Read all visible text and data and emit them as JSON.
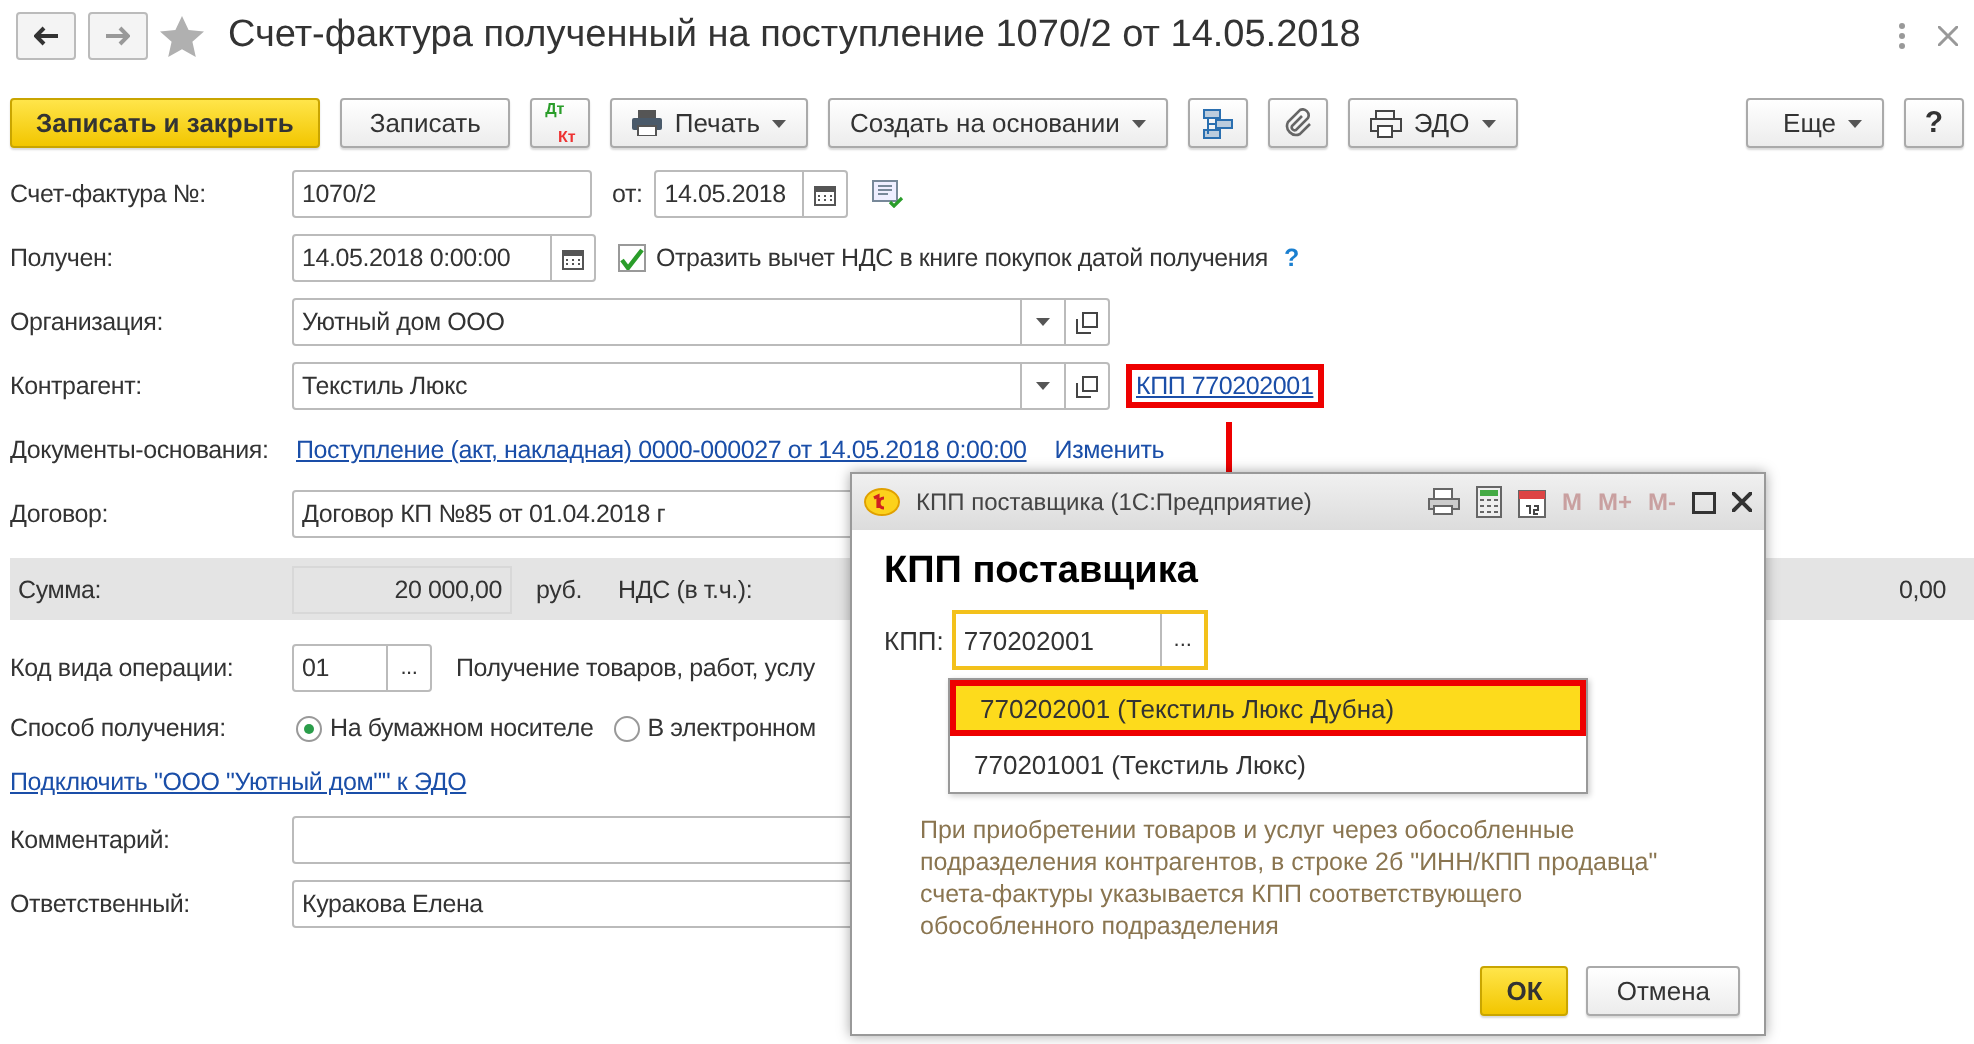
{
  "window": {
    "title": "Счет-фактура полученный на поступление 1070/2 от 14.05.2018",
    "favorite": false
  },
  "toolbar": {
    "save_close": "Записать и закрыть",
    "save": "Записать",
    "dt": "Дт",
    "kt": "Кт",
    "print": "Печать",
    "create_based": "Создать на основании",
    "edo": "ЭДО",
    "more": "Еще",
    "help": "?"
  },
  "form": {
    "invoice_no": {
      "label": "Счет-фактура №:",
      "value": "1070/2",
      "date_label": "от:",
      "date": "14.05.2018"
    },
    "received": {
      "label": "Получен:",
      "value": "14.05.2018  0:00:00",
      "vat_checkbox": {
        "label": "Отразить вычет НДС в книге покупок датой получения",
        "checked": true
      },
      "help": "?"
    },
    "organization": {
      "label": "Организация:",
      "value": "Уютный дом ООО"
    },
    "counterparty": {
      "label": "Контрагент:",
      "value": "Текстиль Люкс",
      "kpp_link": {
        "text": "КПП 770202001",
        "highlighted": true
      }
    },
    "base_documents": {
      "label": "Документы-основания:",
      "link": "Поступление (акт, накладная) 0000-000027 от 14.05.2018 0:00:00",
      "change_link": "Изменить"
    },
    "contract": {
      "label": "Договор:",
      "value": "Договор КП №85 от 01.04.2018 г"
    },
    "totals": {
      "sum_label": "Сумма:",
      "sum": "20 000,00",
      "currency": "руб.",
      "vat_label": "НДС (в т.ч.):",
      "vat": "0,00"
    },
    "operation_code": {
      "label": "Код вида операции:",
      "value": "01",
      "picker": "...",
      "description": "Получение товаров, работ, услу"
    },
    "receipt_method": {
      "label": "Способ получения:",
      "options": [
        {
          "label": "На бумажном носителе",
          "selected": true
        },
        {
          "label": "В электронном",
          "selected": false
        }
      ]
    },
    "edo_link": "Подключить \"ООО \"Уютный дом\"\" к ЭДО",
    "comment": {
      "label": "Комментарий:"
    },
    "responsible": {
      "label": "Ответственный:",
      "value": "Куракова Елена"
    }
  },
  "dialog": {
    "title": "КПП поставщика  (1С:Предприятие)",
    "memory_buttons": [
      "M",
      "M+",
      "M-"
    ],
    "heading": "КПП поставщика",
    "kpp_label": "КПП:",
    "kpp_value": "770202001",
    "picker": "...",
    "suggestions": [
      {
        "label": "770202001 (Текстиль Люкс Дубна)",
        "selected": true,
        "highlighted": true
      },
      {
        "label": "770201001 (Текстиль Люкс)",
        "selected": false,
        "highlighted": false
      }
    ],
    "hint": "При приобретении товаров и услуг через обособленные\nподразделения контрагентов, в строке 2б \"ИНН/КПП продавца\"\nсчета-фактуры указывается КПП соответствующего\nобособленного подразделения",
    "ok": "ОК",
    "cancel": "Отмена"
  }
}
